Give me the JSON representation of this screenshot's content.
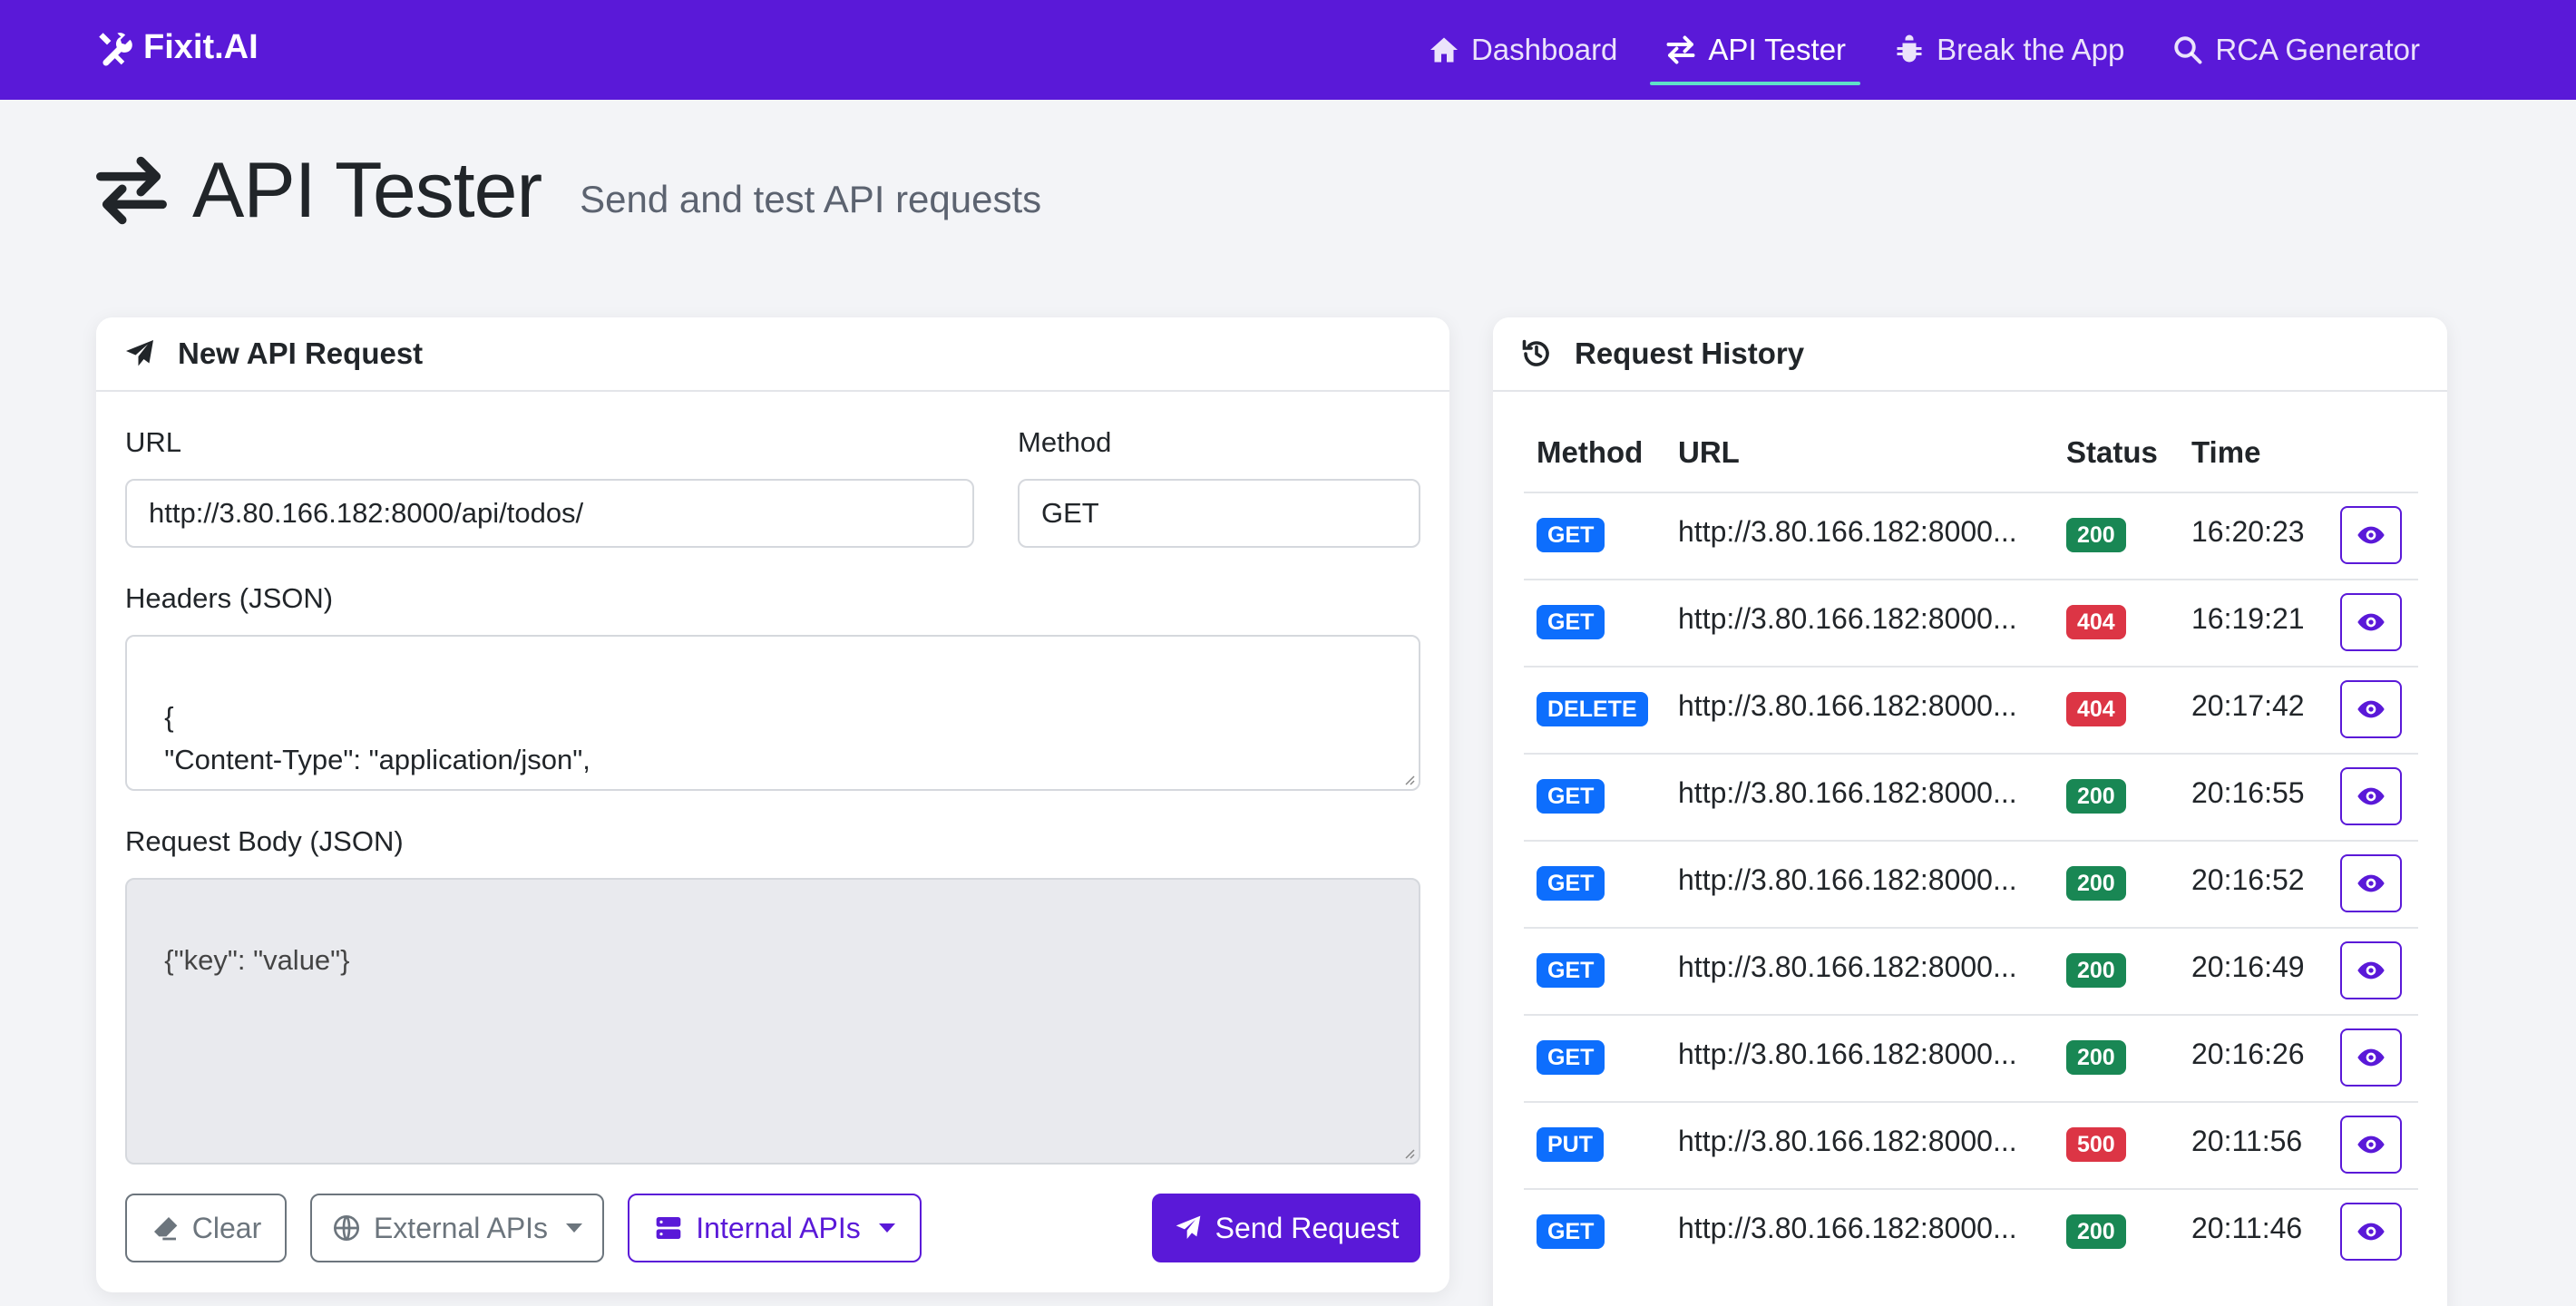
{
  "navbar": {
    "brand": "Fixit.AI",
    "items": [
      {
        "label": "Dashboard",
        "icon": "home-icon",
        "active": false
      },
      {
        "label": "API Tester",
        "icon": "arrows-exchange-icon",
        "active": true
      },
      {
        "label": "Break the App",
        "icon": "bug-icon",
        "active": false
      },
      {
        "label": "RCA Generator",
        "icon": "search-icon",
        "active": false
      }
    ]
  },
  "page": {
    "title": "API Tester",
    "subtitle": "Send and test API requests"
  },
  "request_form": {
    "header": "New API Request",
    "url_label": "URL",
    "url_value": "http://3.80.166.182:8000/api/todos/",
    "method_label": "Method",
    "method_value": "GET",
    "headers_label": "Headers (JSON)",
    "headers_value": "{\n  \"Content-Type\": \"application/json\",\n  \"Accept\": \"application/json\"\n}",
    "body_label": "Request Body (JSON)",
    "body_value": "{\"key\": \"value\"}",
    "buttons": {
      "clear": "Clear",
      "external": "External APIs",
      "internal": "Internal APIs",
      "send": "Send Request"
    }
  },
  "history": {
    "header": "Request History",
    "columns": {
      "method": "Method",
      "url": "URL",
      "status": "Status",
      "time": "Time"
    },
    "rows": [
      {
        "method": "GET",
        "url": "http://3.80.166.182:8000...",
        "status": "200",
        "time": "16:20:23"
      },
      {
        "method": "GET",
        "url": "http://3.80.166.182:8000...",
        "status": "404",
        "time": "16:19:21"
      },
      {
        "method": "DELETE",
        "url": "http://3.80.166.182:8000...",
        "status": "404",
        "time": "20:17:42"
      },
      {
        "method": "GET",
        "url": "http://3.80.166.182:8000...",
        "status": "200",
        "time": "20:16:55"
      },
      {
        "method": "GET",
        "url": "http://3.80.166.182:8000...",
        "status": "200",
        "time": "20:16:52"
      },
      {
        "method": "GET",
        "url": "http://3.80.166.182:8000...",
        "status": "200",
        "time": "20:16:49"
      },
      {
        "method": "GET",
        "url": "http://3.80.166.182:8000...",
        "status": "200",
        "time": "20:16:26"
      },
      {
        "method": "PUT",
        "url": "http://3.80.166.182:8000...",
        "status": "500",
        "time": "20:11:56"
      },
      {
        "method": "GET",
        "url": "http://3.80.166.182:8000...",
        "status": "200",
        "time": "20:11:46"
      }
    ]
  },
  "colors": {
    "brand": "#5a19d8",
    "method_badge": "#0d6efd",
    "status_ok": "#198754",
    "status_error": "#dc3545",
    "nav_underline": "#5fe0c8"
  }
}
